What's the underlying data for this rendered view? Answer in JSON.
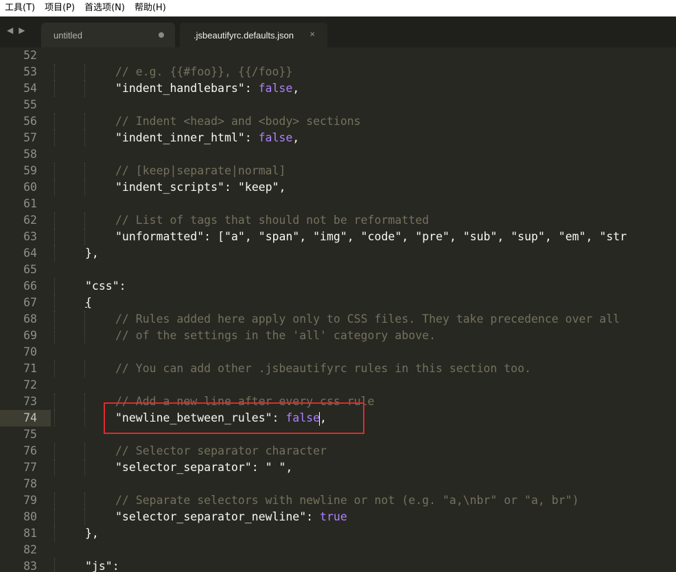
{
  "menu": [
    "工具(T)",
    "项目(P)",
    "首选项(N)",
    "帮助(H)"
  ],
  "tabs": [
    {
      "label": "untitled",
      "modified": true,
      "active": false
    },
    {
      "label": ".jsbeautifyrc.defaults.json",
      "modified": false,
      "active": true
    }
  ],
  "nav": {
    "back_icon": "◀",
    "forward_icon": "▶",
    "close_icon": "×"
  },
  "colors": {
    "background": "#272822",
    "comment": "#75715e",
    "keyword": "#ae81ff",
    "text": "#f8f8f2",
    "highlight_box": "#e22b2b"
  },
  "editor": {
    "current_line": 74,
    "lines": [
      {
        "n": "52",
        "indent": 0,
        "tokens": []
      },
      {
        "n": "53",
        "indent": 2,
        "tokens": [
          {
            "t": "// e.g. {{#foo}}, {{/foo}}",
            "c": "cmt"
          }
        ]
      },
      {
        "n": "54",
        "indent": 2,
        "tokens": [
          {
            "t": "\"indent_handlebars\"",
            "c": "str"
          },
          {
            "t": ": ",
            "c": "pun"
          },
          {
            "t": "false",
            "c": "kw"
          },
          {
            "t": ",",
            "c": "pun"
          }
        ]
      },
      {
        "n": "55",
        "indent": 0,
        "tokens": []
      },
      {
        "n": "56",
        "indent": 2,
        "tokens": [
          {
            "t": "// Indent <head> and <body> sections",
            "c": "cmt"
          }
        ]
      },
      {
        "n": "57",
        "indent": 2,
        "tokens": [
          {
            "t": "\"indent_inner_html\"",
            "c": "str"
          },
          {
            "t": ": ",
            "c": "pun"
          },
          {
            "t": "false",
            "c": "kw"
          },
          {
            "t": ",",
            "c": "pun"
          }
        ]
      },
      {
        "n": "58",
        "indent": 0,
        "tokens": []
      },
      {
        "n": "59",
        "indent": 2,
        "tokens": [
          {
            "t": "// [keep|separate|normal]",
            "c": "cmt"
          }
        ]
      },
      {
        "n": "60",
        "indent": 2,
        "tokens": [
          {
            "t": "\"indent_scripts\"",
            "c": "str"
          },
          {
            "t": ": ",
            "c": "pun"
          },
          {
            "t": "\"keep\"",
            "c": "str"
          },
          {
            "t": ",",
            "c": "pun"
          }
        ]
      },
      {
        "n": "61",
        "indent": 0,
        "tokens": []
      },
      {
        "n": "62",
        "indent": 2,
        "tokens": [
          {
            "t": "// List of tags that should not be reformatted",
            "c": "cmt"
          }
        ]
      },
      {
        "n": "63",
        "indent": 2,
        "tokens": [
          {
            "t": "\"unformatted\"",
            "c": "str"
          },
          {
            "t": ": [",
            "c": "pun"
          },
          {
            "t": "\"a\"",
            "c": "str"
          },
          {
            "t": ", ",
            "c": "pun"
          },
          {
            "t": "\"span\"",
            "c": "str"
          },
          {
            "t": ", ",
            "c": "pun"
          },
          {
            "t": "\"img\"",
            "c": "str"
          },
          {
            "t": ", ",
            "c": "pun"
          },
          {
            "t": "\"code\"",
            "c": "str"
          },
          {
            "t": ", ",
            "c": "pun"
          },
          {
            "t": "\"pre\"",
            "c": "str"
          },
          {
            "t": ", ",
            "c": "pun"
          },
          {
            "t": "\"sub\"",
            "c": "str"
          },
          {
            "t": ", ",
            "c": "pun"
          },
          {
            "t": "\"sup\"",
            "c": "str"
          },
          {
            "t": ", ",
            "c": "pun"
          },
          {
            "t": "\"em\"",
            "c": "str"
          },
          {
            "t": ", ",
            "c": "pun"
          },
          {
            "t": "\"str",
            "c": "str"
          }
        ]
      },
      {
        "n": "64",
        "indent": 1,
        "tokens": [
          {
            "t": "},",
            "c": "pun"
          }
        ]
      },
      {
        "n": "65",
        "indent": 0,
        "tokens": []
      },
      {
        "n": "66",
        "indent": 1,
        "tokens": [
          {
            "t": "\"css\"",
            "c": "str"
          },
          {
            "t": ":",
            "c": "pun"
          }
        ]
      },
      {
        "n": "67",
        "indent": 1,
        "tokens": [
          {
            "t": "{",
            "c": "pun brace-u"
          }
        ]
      },
      {
        "n": "68",
        "indent": 2,
        "tokens": [
          {
            "t": "// Rules added here apply only to CSS files. They take precedence over all",
            "c": "cmt"
          }
        ]
      },
      {
        "n": "69",
        "indent": 2,
        "tokens": [
          {
            "t": "// of the settings in the 'all' category above.",
            "c": "cmt"
          }
        ]
      },
      {
        "n": "70",
        "indent": 0,
        "tokens": []
      },
      {
        "n": "71",
        "indent": 2,
        "tokens": [
          {
            "t": "// You can add other .jsbeautifyrc rules in this section too.",
            "c": "cmt"
          }
        ]
      },
      {
        "n": "72",
        "indent": 0,
        "tokens": []
      },
      {
        "n": "73",
        "indent": 2,
        "tokens": [
          {
            "t": "// Add a new line after every css rule",
            "c": "cmt"
          }
        ]
      },
      {
        "n": "74",
        "indent": 2,
        "tokens": [
          {
            "t": "\"newline_between_rules\"",
            "c": "str"
          },
          {
            "t": ": ",
            "c": "pun"
          },
          {
            "t": "false",
            "c": "kw"
          },
          {
            "t": "|",
            "c": "cursor"
          },
          {
            "t": ",",
            "c": "pun"
          }
        ]
      },
      {
        "n": "75",
        "indent": 0,
        "tokens": []
      },
      {
        "n": "76",
        "indent": 2,
        "tokens": [
          {
            "t": "// Selector separator character",
            "c": "cmt"
          }
        ]
      },
      {
        "n": "77",
        "indent": 2,
        "tokens": [
          {
            "t": "\"selector_separator\"",
            "c": "str"
          },
          {
            "t": ": ",
            "c": "pun"
          },
          {
            "t": "\" \"",
            "c": "str"
          },
          {
            "t": ",",
            "c": "pun"
          }
        ]
      },
      {
        "n": "78",
        "indent": 0,
        "tokens": []
      },
      {
        "n": "79",
        "indent": 2,
        "tokens": [
          {
            "t": "// Separate selectors with newline or not (e.g. \"a,\\nbr\" or \"a, br\")",
            "c": "cmt"
          }
        ]
      },
      {
        "n": "80",
        "indent": 2,
        "tokens": [
          {
            "t": "\"selector_separator_newline\"",
            "c": "str"
          },
          {
            "t": ": ",
            "c": "pun"
          },
          {
            "t": "true",
            "c": "kw"
          }
        ]
      },
      {
        "n": "81",
        "indent": 1,
        "tokens": [
          {
            "t": "},",
            "c": "pun"
          }
        ]
      },
      {
        "n": "82",
        "indent": 0,
        "tokens": []
      },
      {
        "n": "83",
        "indent": 1,
        "tokens": [
          {
            "t": "\"js\"",
            "c": "str"
          },
          {
            "t": ":",
            "c": "pun"
          }
        ]
      }
    ]
  }
}
